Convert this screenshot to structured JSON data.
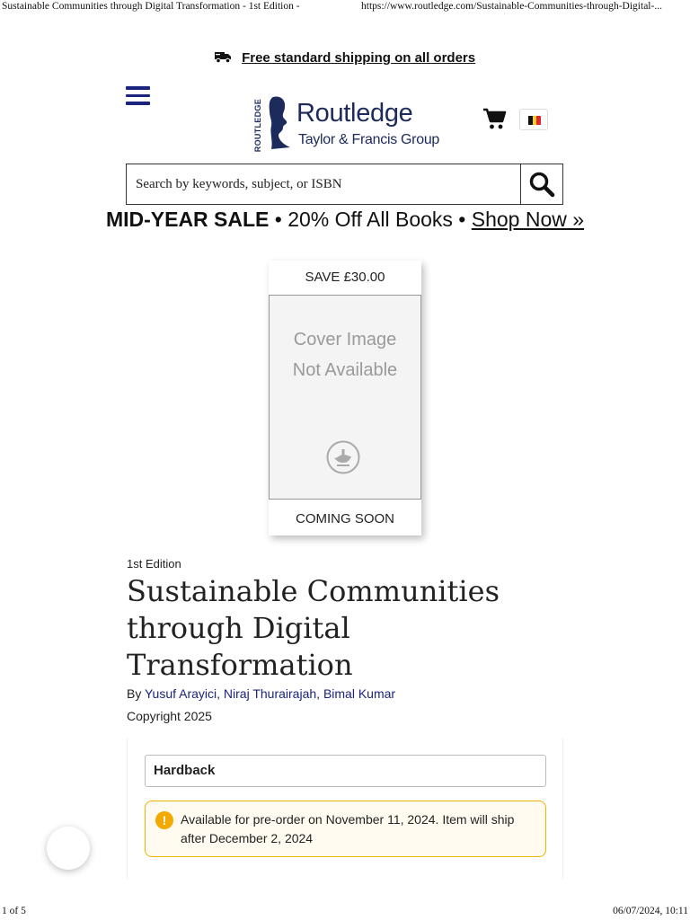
{
  "print_header": {
    "title": "Sustainable Communities through Digital Transformation - 1st Edition -",
    "url": "https://www.routledge.com/Sustainable-Communities-through-Digital-..."
  },
  "shipping_banner": {
    "text": "Free standard shipping on all orders",
    "icon": "truck-icon"
  },
  "header": {
    "menu_icon": "hamburger-menu-icon",
    "logo": {
      "vertical": "ROUTLEDGE",
      "brand": "Routledge",
      "tagline": "Taylor & Francis Group"
    },
    "cart_icon": "shopping-cart-icon",
    "region_flag": {
      "icon": "belgium-flag-icon",
      "colors": [
        "#111111",
        "#f7d117",
        "#e32636"
      ]
    }
  },
  "search": {
    "placeholder": "Search by keywords, subject, or ISBN",
    "icon": "search-icon"
  },
  "sale_banner": {
    "strong": "MID-YEAR SALE",
    "middle": " • 20% Off All Books • ",
    "link": "Shop Now »"
  },
  "cover": {
    "save_label": "SAVE £30.00",
    "placeholder_line1": "Cover Image",
    "placeholder_line2": "Not Available",
    "status": "COMING SOON",
    "icon": "lamp-icon"
  },
  "book": {
    "edition": "1st Edition",
    "title": "Sustainable Communities through Digital Transformation",
    "by": "By ",
    "authors": [
      "Yusuf Arayici",
      "Niraj Thurairajah",
      "Bimal Kumar"
    ],
    "separator": ", ",
    "copyright": "Copyright 2025"
  },
  "format": {
    "selected": "Hardback",
    "alert": "Available for pre-order on November 11, 2024. Item will ship after December 2, 2024",
    "alert_icon": "exclamation-icon",
    "accent_color": "#f2a900"
  },
  "print_footer": {
    "page": "1 of 5",
    "datetime": "06/07/2024, 10:11"
  },
  "colors": {
    "brand_navy": "#1d2a5c",
    "link_blue": "#1a237e"
  }
}
